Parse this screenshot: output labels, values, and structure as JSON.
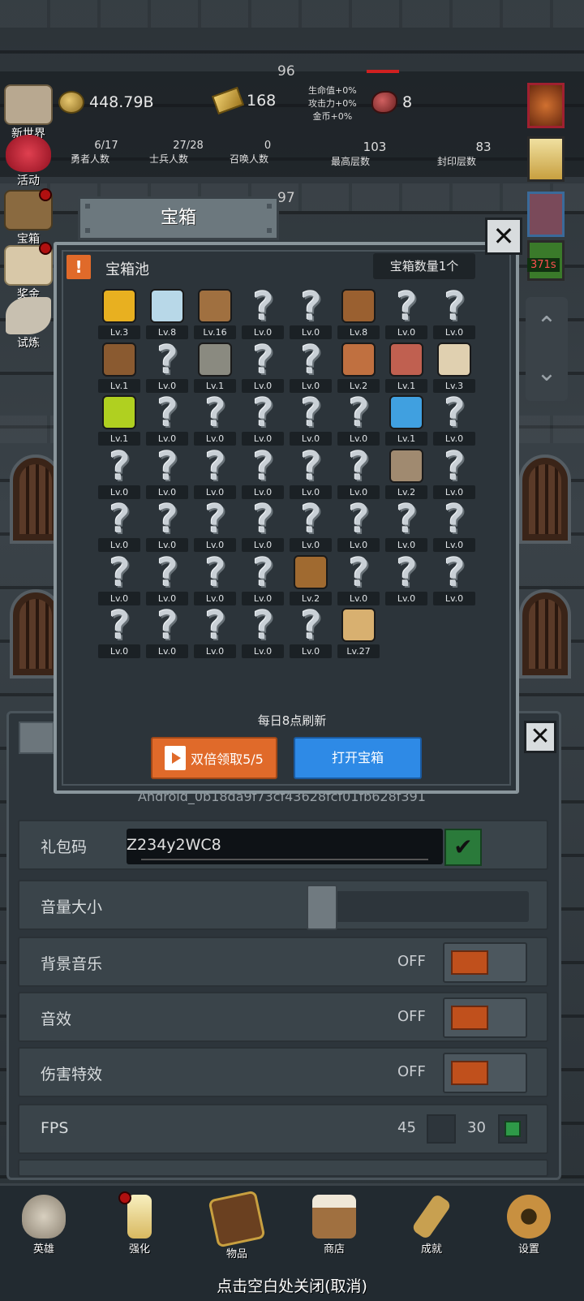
{
  "top": {
    "floor_num_a": "96",
    "floor_num_b": "97",
    "coins": "448.79B",
    "gold": "168",
    "meat": "8",
    "bonus": [
      "生命值+0%",
      "攻击力+0%",
      "金币+0%"
    ],
    "counters": [
      {
        "value": "6/17",
        "label": "勇者人数"
      },
      {
        "value": "27/28",
        "label": "士兵人数"
      },
      {
        "value": "0",
        "label": "召唤人数"
      },
      {
        "value": "103",
        "label": "最高层数"
      },
      {
        "value": "83",
        "label": "封印层数"
      }
    ],
    "timer": "371s"
  },
  "left_menu": [
    {
      "label": "新世界",
      "icon": "stone-tablet-icon"
    },
    {
      "label": "活动",
      "icon": "heart-icon"
    },
    {
      "label": "宝箱",
      "icon": "chest-icon"
    },
    {
      "label": "奖金",
      "icon": "envelope-icon"
    },
    {
      "label": "试炼",
      "icon": "feather-icon"
    }
  ],
  "modal": {
    "title": "宝箱",
    "pool_label": "宝箱池",
    "chest_count": "宝箱数量1个",
    "refresh_note": "每日8点刷新",
    "double_button": "双倍领取5/5",
    "open_button": "打开宝箱",
    "items": [
      {
        "lv": "Lv.3",
        "icon": "crown-icon",
        "color": "#e8b020"
      },
      {
        "lv": "Lv.8",
        "icon": "diamond-icon",
        "color": "#b8d8e8"
      },
      {
        "lv": "Lv.16",
        "icon": "sword-icon",
        "color": "#a07040"
      },
      {
        "lv": "Lv.0",
        "icon": "unknown"
      },
      {
        "lv": "Lv.0",
        "icon": "unknown"
      },
      {
        "lv": "Lv.8",
        "icon": "leather-armor-icon",
        "color": "#9a6030"
      },
      {
        "lv": "Lv.0",
        "icon": "unknown"
      },
      {
        "lv": "Lv.0",
        "icon": "unknown"
      },
      {
        "lv": "Lv.1",
        "icon": "leather-helmet-icon",
        "color": "#8a5a30"
      },
      {
        "lv": "Lv.0",
        "icon": "unknown"
      },
      {
        "lv": "Lv.1",
        "icon": "iron-helmet-icon",
        "color": "#8a8a80"
      },
      {
        "lv": "Lv.0",
        "icon": "unknown"
      },
      {
        "lv": "Lv.0",
        "icon": "unknown"
      },
      {
        "lv": "Lv.2",
        "icon": "meat-leg-icon",
        "color": "#c07040"
      },
      {
        "lv": "Lv.1",
        "icon": "steak-icon",
        "color": "#c06050"
      },
      {
        "lv": "Lv.3",
        "icon": "rice-bowl-icon",
        "color": "#e0d0b0"
      },
      {
        "lv": "Lv.1",
        "icon": "green-potion-icon",
        "color": "#b0d020"
      },
      {
        "lv": "Lv.0",
        "icon": "unknown"
      },
      {
        "lv": "Lv.0",
        "icon": "unknown"
      },
      {
        "lv": "Lv.0",
        "icon": "unknown"
      },
      {
        "lv": "Lv.0",
        "icon": "unknown"
      },
      {
        "lv": "Lv.0",
        "icon": "unknown"
      },
      {
        "lv": "Lv.1",
        "icon": "blue-potion-icon",
        "color": "#40a0e0"
      },
      {
        "lv": "Lv.0",
        "icon": "unknown"
      },
      {
        "lv": "Lv.0",
        "icon": "unknown"
      },
      {
        "lv": "Lv.0",
        "icon": "unknown"
      },
      {
        "lv": "Lv.0",
        "icon": "unknown"
      },
      {
        "lv": "Lv.0",
        "icon": "unknown"
      },
      {
        "lv": "Lv.0",
        "icon": "unknown"
      },
      {
        "lv": "Lv.0",
        "icon": "unknown"
      },
      {
        "lv": "Lv.2",
        "icon": "boots-icon",
        "color": "#a08a70"
      },
      {
        "lv": "Lv.0",
        "icon": "unknown"
      },
      {
        "lv": "Lv.0",
        "icon": "unknown"
      },
      {
        "lv": "Lv.0",
        "icon": "unknown"
      },
      {
        "lv": "Lv.0",
        "icon": "unknown"
      },
      {
        "lv": "Lv.0",
        "icon": "unknown"
      },
      {
        "lv": "Lv.0",
        "icon": "unknown"
      },
      {
        "lv": "Lv.0",
        "icon": "unknown"
      },
      {
        "lv": "Lv.0",
        "icon": "unknown"
      },
      {
        "lv": "Lv.0",
        "icon": "unknown"
      },
      {
        "lv": "Lv.0",
        "icon": "unknown"
      },
      {
        "lv": "Lv.0",
        "icon": "unknown"
      },
      {
        "lv": "Lv.0",
        "icon": "unknown"
      },
      {
        "lv": "Lv.0",
        "icon": "unknown"
      },
      {
        "lv": "Lv.2",
        "icon": "backpack-icon",
        "color": "#a06a30"
      },
      {
        "lv": "Lv.0",
        "icon": "unknown"
      },
      {
        "lv": "Lv.0",
        "icon": "unknown"
      },
      {
        "lv": "Lv.0",
        "icon": "unknown"
      },
      {
        "lv": "Lv.0",
        "icon": "unknown"
      },
      {
        "lv": "Lv.0",
        "icon": "unknown"
      },
      {
        "lv": "Lv.0",
        "icon": "unknown"
      },
      {
        "lv": "Lv.0",
        "icon": "unknown"
      },
      {
        "lv": "Lv.0",
        "icon": "unknown"
      },
      {
        "lv": "Lv.27",
        "icon": "beer-mug-icon",
        "color": "#d8b070"
      }
    ]
  },
  "settings": {
    "device_id_partial": "Android_0b18da9f73cf43628fcf01fb628f391",
    "gift_code_label": "礼包码",
    "gift_code_value": "Z234y2WC8",
    "volume_label": "音量大小",
    "volume_level": 0.0,
    "rows": [
      {
        "label": "背景音乐",
        "state": "OFF"
      },
      {
        "label": "音效",
        "state": "OFF"
      },
      {
        "label": "伤害特效",
        "state": "OFF"
      }
    ],
    "fps_label": "FPS",
    "fps_options": [
      "45",
      "30"
    ],
    "fps_selected": "30"
  },
  "bottom_nav": [
    {
      "label": "英雄",
      "icon": "skull-icon"
    },
    {
      "label": "强化",
      "icon": "candle-icon"
    },
    {
      "label": "物品",
      "icon": "book-icon"
    },
    {
      "label": "商店",
      "icon": "mug-icon"
    },
    {
      "label": "成就",
      "icon": "key-icon"
    },
    {
      "label": "设置",
      "icon": "gear-icon"
    }
  ],
  "close_hint": "点击空白处关闭(取消)"
}
